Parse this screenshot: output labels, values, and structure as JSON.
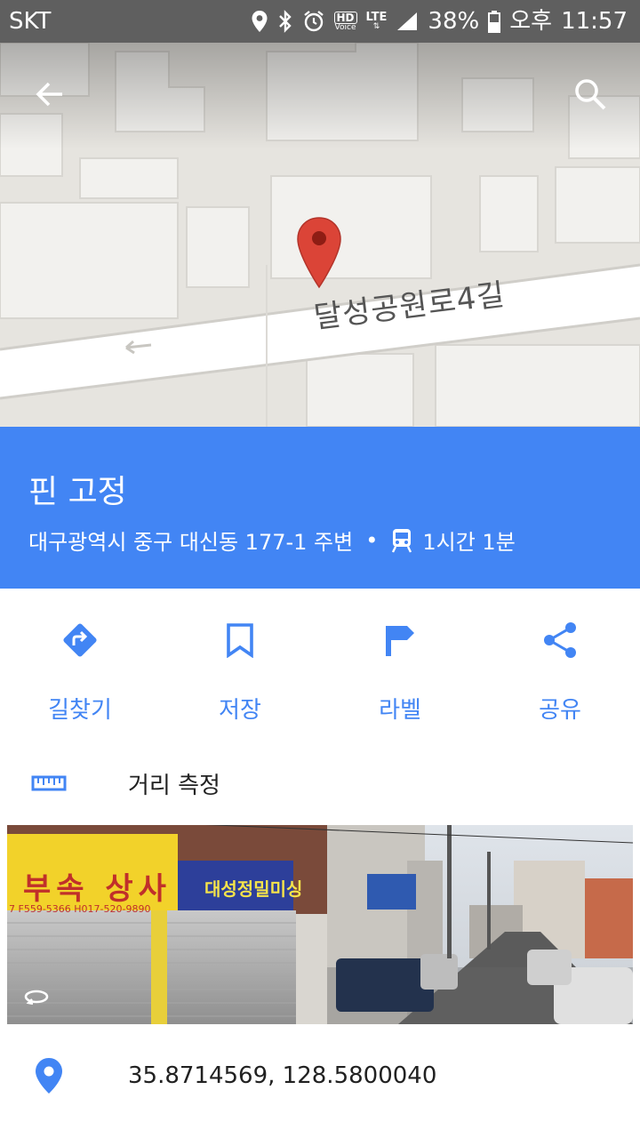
{
  "status_bar": {
    "carrier": "SKT",
    "battery": "38%",
    "ampm": "오후",
    "time": "11:57",
    "hd_label": "HD",
    "voice_label": "Voice",
    "lte_label": "LTE"
  },
  "map": {
    "street_name": "달성공원로4길"
  },
  "place": {
    "title": "핀 고정",
    "address": "대구광역시 중구 대신동 177-1 주변",
    "separator": "•",
    "transit_time": "1시간 1분"
  },
  "actions": [
    {
      "label": "길찾기",
      "icon": "directions-icon"
    },
    {
      "label": "저장",
      "icon": "bookmark-icon"
    },
    {
      "label": "라벨",
      "icon": "flag-icon"
    },
    {
      "label": "공유",
      "icon": "share-icon"
    }
  ],
  "measure": {
    "label": "거리 측정"
  },
  "street_view": {
    "sign_left": "부속 상사",
    "sign_left_phone": "7 F559-5366 H017-520-9890",
    "sign_right": "대성정밀미싱"
  },
  "coordinates": {
    "value": "35.8714569, 128.5800040"
  },
  "colors": {
    "accent": "#4285f4",
    "status_bar": "#5f5f5f",
    "pin": "#db4437"
  }
}
